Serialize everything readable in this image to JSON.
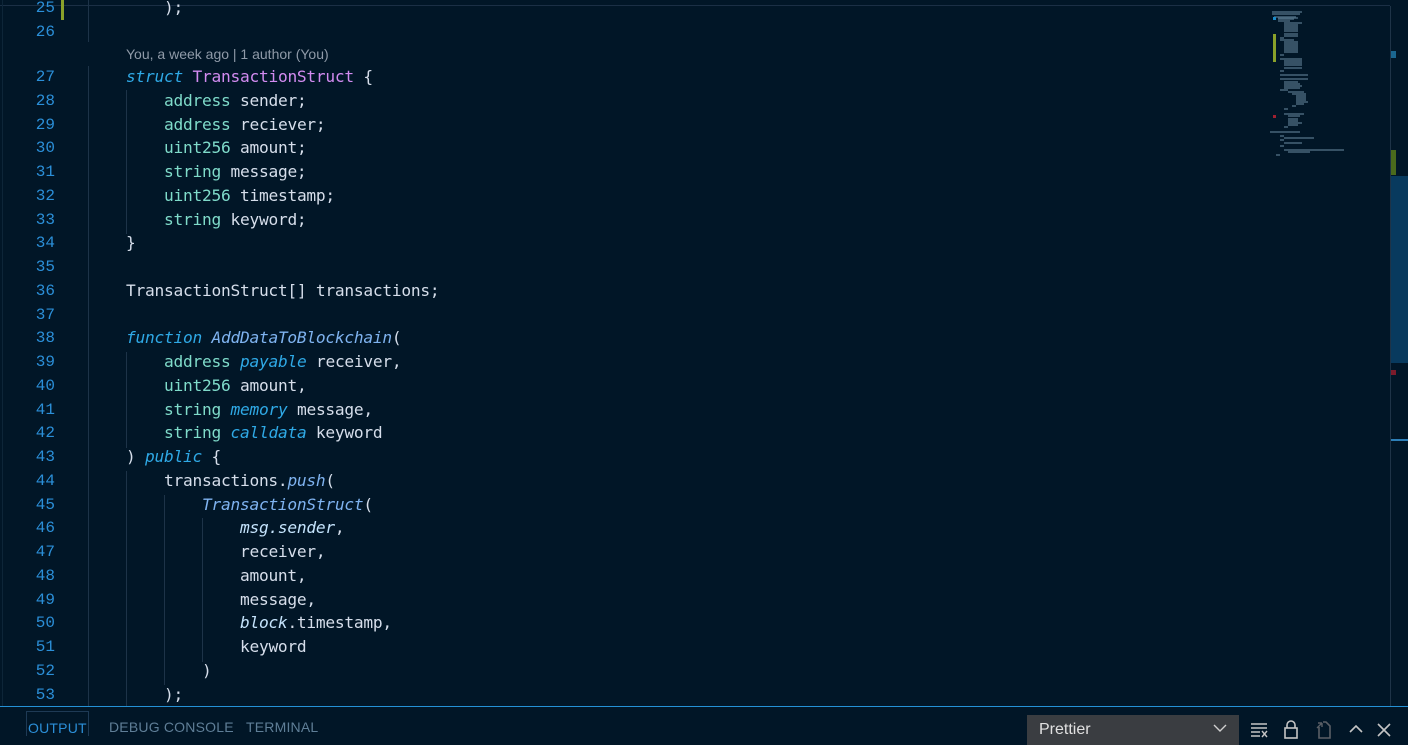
{
  "editor": {
    "codelens": "You, a week ago | 1 author (You)",
    "lines": [
      {
        "n": "25",
        "tokens": [
          [
            "punc",
            "    );"
          ]
        ]
      },
      {
        "n": "26",
        "tokens": []
      },
      {
        "n": "27",
        "tokens": [
          [
            "kw-it",
            "struct"
          ],
          [
            "punc",
            " "
          ],
          [
            "cls",
            "TransactionStruct"
          ],
          [
            "punc",
            " {"
          ]
        ]
      },
      {
        "n": "28",
        "tokens": [
          [
            "punc",
            "    "
          ],
          [
            "type",
            "address"
          ],
          [
            "var",
            " sender;"
          ]
        ]
      },
      {
        "n": "29",
        "tokens": [
          [
            "punc",
            "    "
          ],
          [
            "type",
            "address"
          ],
          [
            "var",
            " reciever;"
          ]
        ]
      },
      {
        "n": "30",
        "tokens": [
          [
            "punc",
            "    "
          ],
          [
            "type",
            "uint256"
          ],
          [
            "var",
            " amount;"
          ]
        ]
      },
      {
        "n": "31",
        "tokens": [
          [
            "punc",
            "    "
          ],
          [
            "type",
            "string"
          ],
          [
            "var",
            " message;"
          ]
        ]
      },
      {
        "n": "32",
        "tokens": [
          [
            "punc",
            "    "
          ],
          [
            "type",
            "uint256"
          ],
          [
            "var",
            " timestamp;"
          ]
        ]
      },
      {
        "n": "33",
        "tokens": [
          [
            "punc",
            "    "
          ],
          [
            "type",
            "string"
          ],
          [
            "var",
            " keyword;"
          ]
        ]
      },
      {
        "n": "34",
        "tokens": [
          [
            "punc",
            "}"
          ]
        ]
      },
      {
        "n": "35",
        "tokens": []
      },
      {
        "n": "36",
        "tokens": [
          [
            "var",
            "TransactionStruct[] transactions;"
          ]
        ]
      },
      {
        "n": "37",
        "tokens": []
      },
      {
        "n": "38",
        "tokens": [
          [
            "kw-it",
            "function"
          ],
          [
            "punc",
            " "
          ],
          [
            "fn-it",
            "AddDataToBlockchain"
          ],
          [
            "punc",
            "("
          ]
        ]
      },
      {
        "n": "39",
        "tokens": [
          [
            "punc",
            "    "
          ],
          [
            "type",
            "address"
          ],
          [
            "punc",
            " "
          ],
          [
            "kw-it",
            "payable"
          ],
          [
            "var",
            " receiver,"
          ]
        ]
      },
      {
        "n": "40",
        "tokens": [
          [
            "punc",
            "    "
          ],
          [
            "type",
            "uint256"
          ],
          [
            "var",
            " amount,"
          ]
        ]
      },
      {
        "n": "41",
        "tokens": [
          [
            "punc",
            "    "
          ],
          [
            "type",
            "string"
          ],
          [
            "punc",
            " "
          ],
          [
            "kw-it",
            "memory"
          ],
          [
            "var",
            " message,"
          ]
        ]
      },
      {
        "n": "42",
        "tokens": [
          [
            "punc",
            "    "
          ],
          [
            "type",
            "string"
          ],
          [
            "punc",
            " "
          ],
          [
            "kw-it",
            "calldata"
          ],
          [
            "var",
            " keyword"
          ]
        ]
      },
      {
        "n": "43",
        "tokens": [
          [
            "punc",
            ") "
          ],
          [
            "kw-it",
            "public"
          ],
          [
            "punc",
            " {"
          ]
        ]
      },
      {
        "n": "44",
        "tokens": [
          [
            "punc",
            "    "
          ],
          [
            "var",
            "transactions."
          ],
          [
            "fn-it",
            "push"
          ],
          [
            "punc",
            "("
          ]
        ]
      },
      {
        "n": "45",
        "tokens": [
          [
            "punc",
            "        "
          ],
          [
            "fn-it",
            "TransactionStruct"
          ],
          [
            "punc",
            "("
          ]
        ]
      },
      {
        "n": "46",
        "tokens": [
          [
            "punc",
            "            "
          ],
          [
            "var-it",
            "msg.sender"
          ],
          [
            "punc",
            ","
          ]
        ]
      },
      {
        "n": "47",
        "tokens": [
          [
            "punc",
            "            "
          ],
          [
            "var",
            "receiver,"
          ]
        ]
      },
      {
        "n": "48",
        "tokens": [
          [
            "punc",
            "            "
          ],
          [
            "var",
            "amount,"
          ]
        ]
      },
      {
        "n": "49",
        "tokens": [
          [
            "punc",
            "            "
          ],
          [
            "var",
            "message,"
          ]
        ]
      },
      {
        "n": "50",
        "tokens": [
          [
            "punc",
            "            "
          ],
          [
            "var-it",
            "block"
          ],
          [
            "var",
            ".timestamp,"
          ]
        ]
      },
      {
        "n": "51",
        "tokens": [
          [
            "punc",
            "            "
          ],
          [
            "var",
            "keyword"
          ]
        ]
      },
      {
        "n": "52",
        "tokens": [
          [
            "punc",
            "        )"
          ]
        ]
      },
      {
        "n": "53",
        "tokens": [
          [
            "punc",
            "    );"
          ]
        ]
      }
    ]
  },
  "panel": {
    "tabs": [
      {
        "label": "OUTPUT",
        "active": true
      },
      {
        "label": "DEBUG CONSOLE",
        "active": false
      },
      {
        "label": "TERMINAL",
        "active": false
      }
    ],
    "output_channel": "Prettier",
    "icons": [
      "clear-output-icon",
      "lock-scroll-icon",
      "open-in-editor-icon",
      "maximize-panel-icon",
      "close-panel-icon"
    ]
  },
  "colors": {
    "background": "#011627",
    "line_number": "#2b8fd8",
    "accent": "#2491d6"
  }
}
